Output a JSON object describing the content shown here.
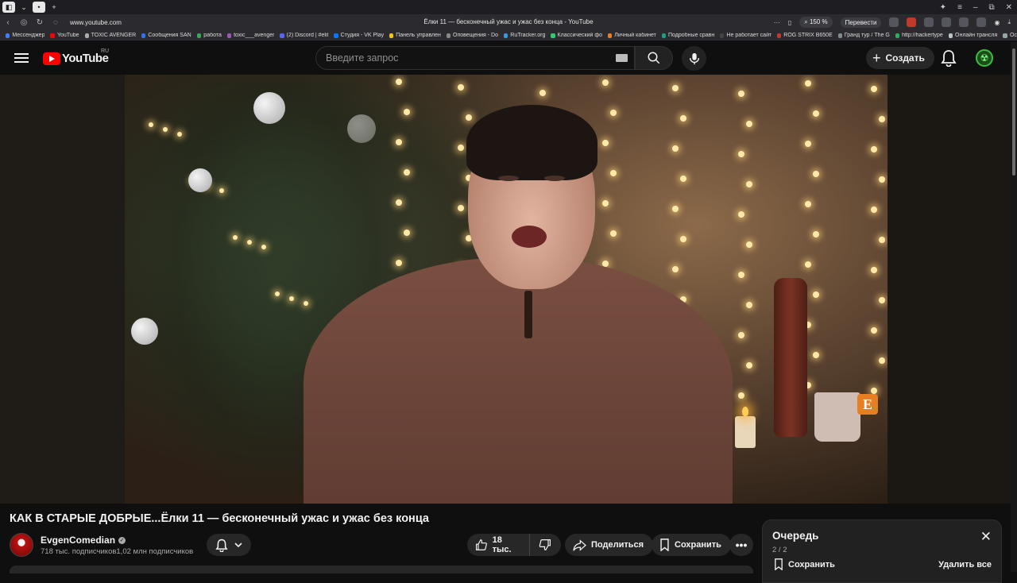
{
  "browser": {
    "url": "www.youtube.com",
    "tab_title": "Ёлки 11 — бесконечный ужас и ужас без конца - YouTube",
    "zoom": "150 %",
    "translate_label": "Перевести",
    "bookmarks": [
      {
        "label": "Мессенджер",
        "color": "#3b82f6"
      },
      {
        "label": "YouTube",
        "color": "#ff0000"
      },
      {
        "label": "TOXIC AVENGER",
        "color": "#aaaaaa"
      },
      {
        "label": "Сообщения SAN",
        "color": "#2f6ff0"
      },
      {
        "label": "работа",
        "color": "#34a853"
      },
      {
        "label": "toxic___avenger",
        "color": "#9b59b6"
      },
      {
        "label": "(2) Discord | #elit",
        "color": "#5865f2"
      },
      {
        "label": "Студия - VK Play",
        "color": "#0077ff"
      },
      {
        "label": "Панель управлен",
        "color": "#f1c40f"
      },
      {
        "label": "Оповещения - Do",
        "color": "#888888"
      },
      {
        "label": "RuTracker.org",
        "color": "#3498db"
      },
      {
        "label": "Классический фо",
        "color": "#2ecc71"
      },
      {
        "label": "Личный кабинет",
        "color": "#e67e22"
      },
      {
        "label": "Подробные сравн",
        "color": "#16a085"
      },
      {
        "label": "Не работает сайт",
        "color": "#444444"
      },
      {
        "label": "ROG STRIX B650E",
        "color": "#c0392b"
      },
      {
        "label": "Гранд тур / The G",
        "color": "#7f8c8d"
      },
      {
        "label": "http://hackertype",
        "color": "#27ae60"
      },
      {
        "label": "Онлайн трансля",
        "color": "#bdc3c7"
      },
      {
        "label": "Ос",
        "color": "#95a5a6"
      }
    ]
  },
  "header": {
    "logo_text": "YouTube",
    "country_code": "RU",
    "search_placeholder": "Введите запрос",
    "create_label": "Создать"
  },
  "video": {
    "title": "КАК В СТАРЫЕ ДОБРЫЕ...Ёлки 11 — бесконечный ужас и ужас без конца",
    "watermark_letter": "E"
  },
  "channel": {
    "name": "EvgenComedian",
    "subscribers": "718 тыс. подписчиков1,02 млн подписчиков"
  },
  "actions": {
    "likes": "18 тыс.",
    "share_label": "Поделиться",
    "save_label": "Сохранить"
  },
  "queue": {
    "title": "Очередь",
    "count": "2 / 2",
    "save_label": "Сохранить",
    "clear_label": "Удалить все"
  }
}
